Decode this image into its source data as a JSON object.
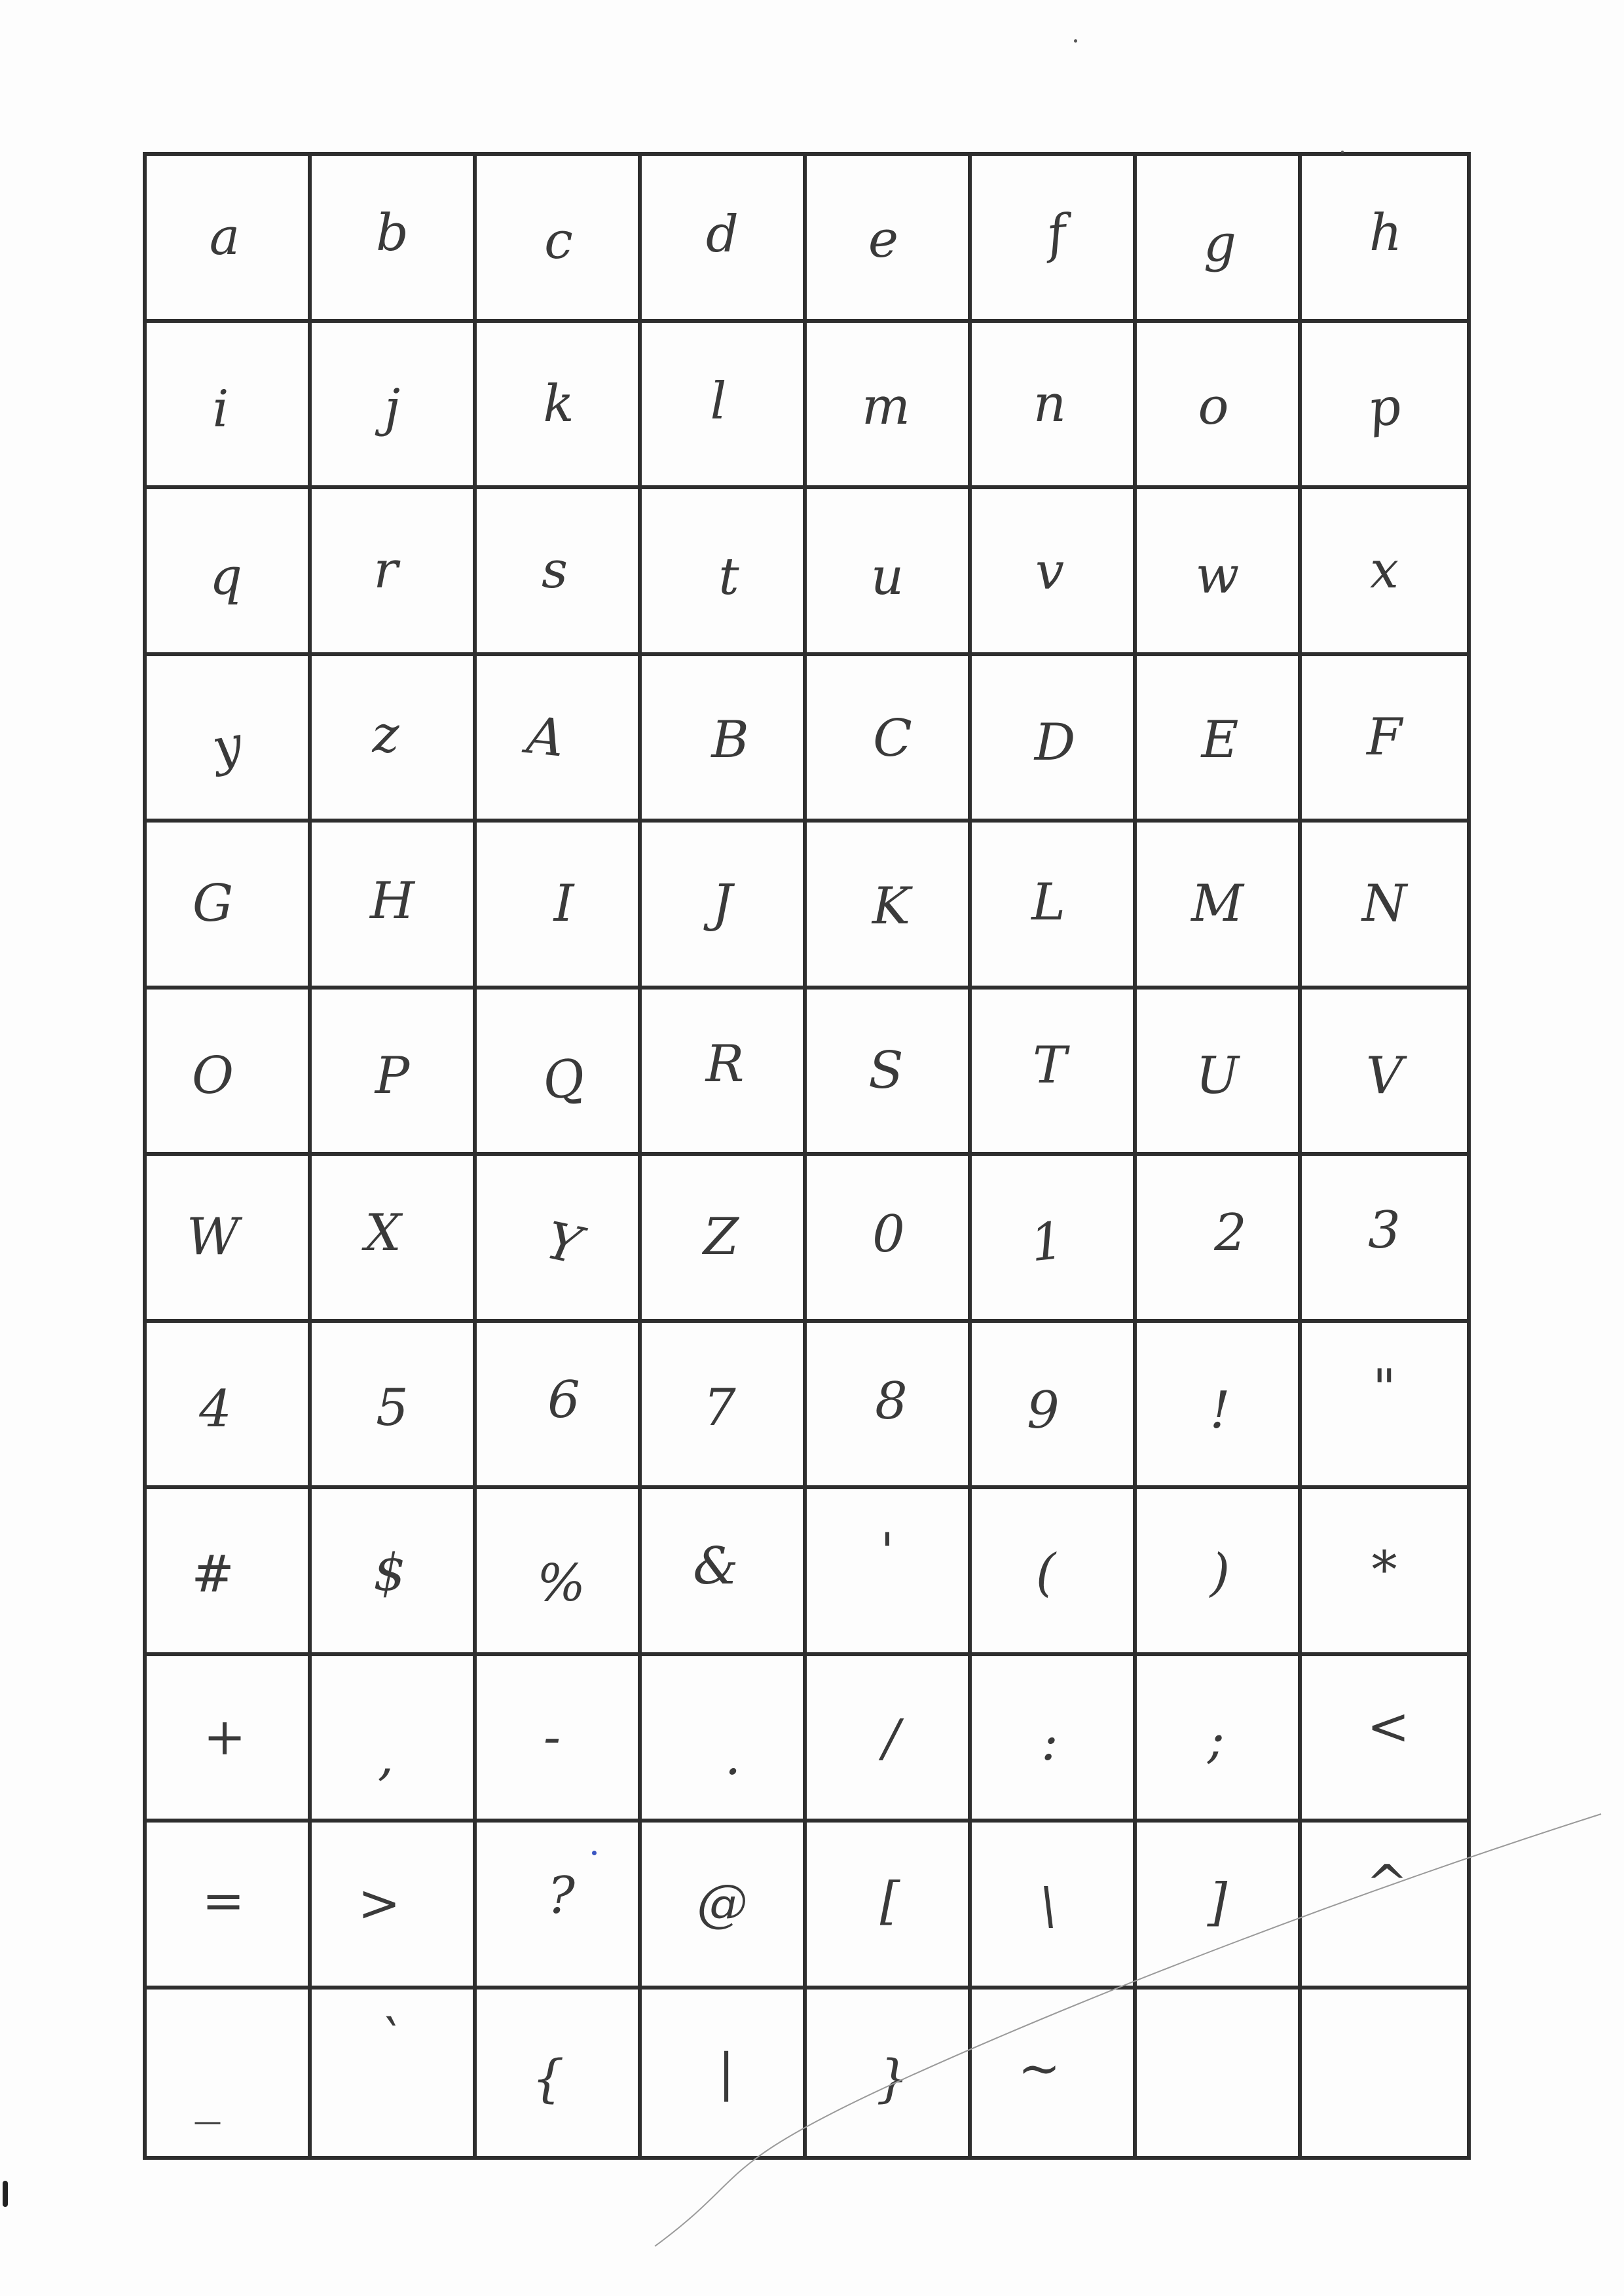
{
  "sheet": {
    "rows": [
      [
        "a",
        "b",
        "c",
        "d",
        "e",
        "f",
        "g",
        "h"
      ],
      [
        "i",
        "j",
        "k",
        "l",
        "m",
        "n",
        "o",
        "p"
      ],
      [
        "q",
        "r",
        "s",
        "t",
        "u",
        "v",
        "w",
        "x"
      ],
      [
        "y",
        "z",
        "A",
        "B",
        "C",
        "D",
        "E",
        "F"
      ],
      [
        "G",
        "H",
        "I",
        "J",
        "K",
        "L",
        "M",
        "N"
      ],
      [
        "O",
        "P",
        "Q",
        "R",
        "S",
        "T",
        "U",
        "V"
      ],
      [
        "W",
        "X",
        "Y",
        "Z",
        "0",
        "1",
        "2",
        "3"
      ],
      [
        "4",
        "5",
        "6",
        "7",
        "8",
        "9",
        "!",
        "\""
      ],
      [
        "#",
        "$",
        "%",
        "&",
        "'",
        "(",
        ")",
        "*"
      ],
      [
        "+",
        ",",
        "-",
        ".",
        "/",
        ":",
        ";",
        "<"
      ],
      [
        "=",
        ">",
        "?",
        "@",
        "[",
        "\\",
        "]",
        "^"
      ],
      [
        "_",
        "`",
        "{",
        "|",
        "}",
        "~",
        "",
        ""
      ]
    ]
  },
  "colors": {
    "grid_line": "#2e2e2e",
    "ink": "#3a3a3a",
    "paper": "#fdfdfd"
  }
}
